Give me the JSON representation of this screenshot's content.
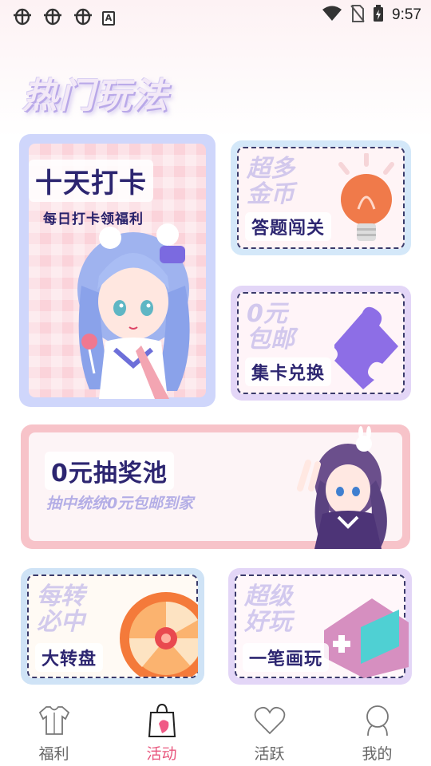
{
  "status_bar": {
    "time": "9:57",
    "left_icons": [
      "bug-icon",
      "bug-icon",
      "bug-icon",
      "text-a-icon"
    ],
    "right_icons": [
      "wifi-icon",
      "no-sim-icon",
      "battery-charging-icon"
    ]
  },
  "section": {
    "title": "热门玩法"
  },
  "cards": {
    "checkin": {
      "title": "十天打卡",
      "subtitle": "每日打卡领福利"
    },
    "quiz": {
      "faint_text": "超多\n金币",
      "label": "答题闯关"
    },
    "puzzle": {
      "faint_text": "0元\n包邮",
      "label": "集卡兑换"
    },
    "lottery": {
      "title": "0元抽奖池",
      "subtitle": "抽中统统0元包邮到家"
    },
    "wheel": {
      "faint_text": "每转\n必中",
      "label": "大转盘"
    },
    "draw": {
      "faint_text": "超级\n好玩",
      "label": "一笔画玩"
    }
  },
  "bottom_nav": {
    "items": [
      {
        "label": "福利",
        "icon": "shirt-icon",
        "active": false
      },
      {
        "label": "活动",
        "icon": "gift-bag-icon",
        "active": true
      },
      {
        "label": "活跃",
        "icon": "heart-icon",
        "active": false
      },
      {
        "label": "我的",
        "icon": "person-icon",
        "active": false
      }
    ]
  },
  "colors": {
    "accent": "#e8577e",
    "title_ink": "#2c2570",
    "inactive": "#666666"
  }
}
